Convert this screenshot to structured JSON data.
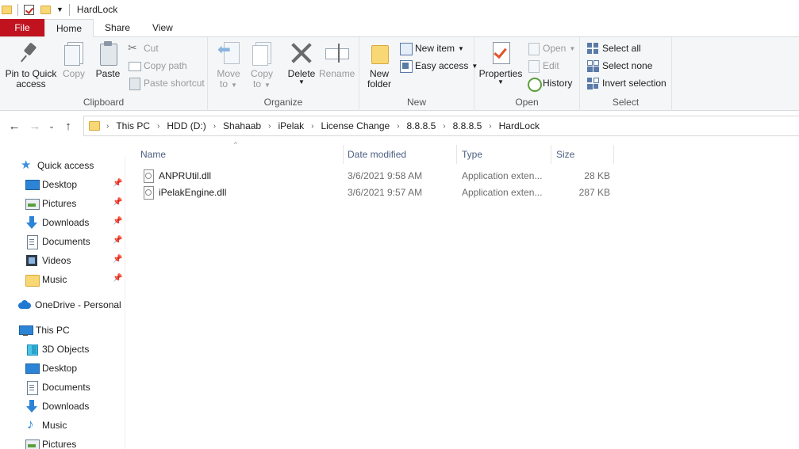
{
  "window": {
    "title": "HardLock"
  },
  "tabs": [
    {
      "label": "File"
    },
    {
      "label": "Home"
    },
    {
      "label": "Share"
    },
    {
      "label": "View"
    }
  ],
  "ribbon": {
    "clipboard": {
      "label": "Clipboard",
      "pin": "Pin to Quick access",
      "pin_line1": "Pin to Quick",
      "pin_line2": "access",
      "copy": "Copy",
      "paste": "Paste",
      "cut": "Cut",
      "copy_path": "Copy path",
      "paste_shortcut": "Paste shortcut"
    },
    "organize": {
      "label": "Organize",
      "move_to_line1": "Move",
      "move_to_line2": "to",
      "copy_to_line1": "Copy",
      "copy_to_line2": "to",
      "delete": "Delete",
      "rename": "Rename"
    },
    "new": {
      "label": "New",
      "new_folder_line1": "New",
      "new_folder_line2": "folder",
      "new_item": "New item",
      "easy_access": "Easy access"
    },
    "open": {
      "label": "Open",
      "properties": "Properties",
      "open": "Open",
      "edit": "Edit",
      "history": "History"
    },
    "select": {
      "label": "Select",
      "select_all": "Select all",
      "select_none": "Select none",
      "invert_selection": "Invert selection"
    }
  },
  "breadcrumb": [
    "This PC",
    "HDD (D:)",
    "Shahaab",
    "iPelak",
    "License Change",
    "8.8.8.5",
    "8.8.8.5",
    "HardLock"
  ],
  "sidebar": {
    "quick_access": "Quick access",
    "quick_items": [
      {
        "label": "Desktop",
        "icon": "desktop-icon"
      },
      {
        "label": "Pictures",
        "icon": "pictures-icon"
      },
      {
        "label": "Downloads",
        "icon": "downloads-icon"
      },
      {
        "label": "Documents",
        "icon": "documents-icon"
      },
      {
        "label": "Videos",
        "icon": "videos-icon"
      },
      {
        "label": "Music",
        "icon": "folder-icon"
      }
    ],
    "onedrive": "OneDrive - Personal",
    "this_pc": "This PC",
    "pc_items": [
      {
        "label": "3D Objects",
        "icon": "3d-objects-icon"
      },
      {
        "label": "Desktop",
        "icon": "desktop-icon"
      },
      {
        "label": "Documents",
        "icon": "documents-icon"
      },
      {
        "label": "Downloads",
        "icon": "downloads-icon"
      },
      {
        "label": "Music",
        "icon": "music-icon"
      },
      {
        "label": "Pictures",
        "icon": "pictures-icon"
      }
    ]
  },
  "filelist": {
    "columns": {
      "name": "Name",
      "date": "Date modified",
      "type": "Type",
      "size": "Size"
    },
    "files": [
      {
        "name": "ANPRUtil.dll",
        "date": "3/6/2021 9:58 AM",
        "type": "Application exten...",
        "size": "28 KB"
      },
      {
        "name": "iPelakEngine.dll",
        "date": "3/6/2021 9:57 AM",
        "type": "Application exten...",
        "size": "287 KB"
      }
    ]
  },
  "colors": {
    "file_tab": "#c1121f",
    "header_text": "#4d6082",
    "accent": "#2b84d6"
  }
}
